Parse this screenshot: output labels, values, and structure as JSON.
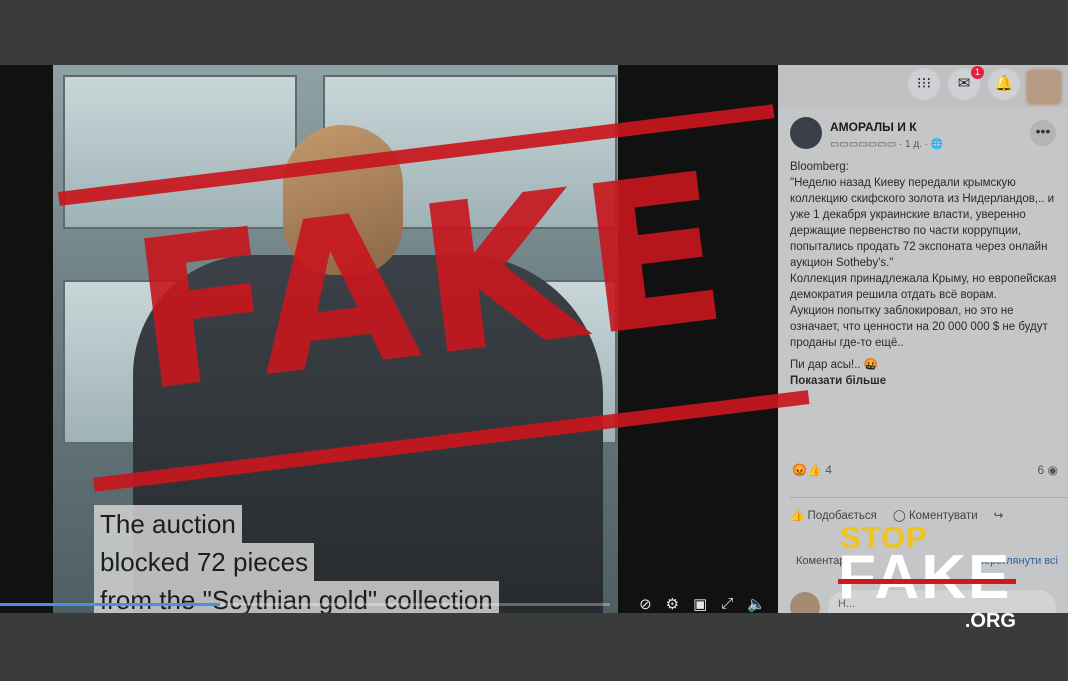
{
  "video": {
    "caption_lines": [
      "The auction",
      "blocked 72 pieces",
      "from the \"Scythian gold\" collection"
    ],
    "progress": 0.36,
    "controls": [
      "subtitles-icon",
      "settings-icon",
      "pip-icon",
      "fullscreen-icon",
      "mute-icon"
    ]
  },
  "facebook": {
    "messenger_badge": "1",
    "post": {
      "page_name": "АМОРАЛЫ И К",
      "time": "1 д.",
      "paragraphs": [
        "Bloomberg:",
        "\"Неделю назад Киеву передали крымскую коллекцию скифского золота из Нидерландов,.. и уже 1 декабря украинские власти, уверенно держащие первенство по части коррупции, попытались продать 72 экспоната через онлайн аукцион Sotheby's.\"",
        "Коллекция принадлежала Крыму, но европейская демократия решила отдать всё ворам.",
        "Аукцион попытку заблокировал, но это не означает, что ценности на 20 000 000 $ не будут проданы где-то ещё..",
        "Пи дар асы!.. 🤬"
      ],
      "show_more": "Показати більше",
      "reactions_count": "4",
      "shares_count": "6",
      "actions": {
        "like": "Подобається",
        "comment": "Коментувати"
      },
      "comments_label": "Коментарі",
      "view_all": "Переглянути всі",
      "comment_placeholder": "Н..."
    }
  },
  "stamp": {
    "text": "FAKE",
    "color": "#c8161d"
  },
  "logo": {
    "stop": "STOP",
    "fake": "FAKE",
    "org": ".ORG",
    "stop_color": "#f2c31a",
    "strike_color": "#d0191f"
  }
}
